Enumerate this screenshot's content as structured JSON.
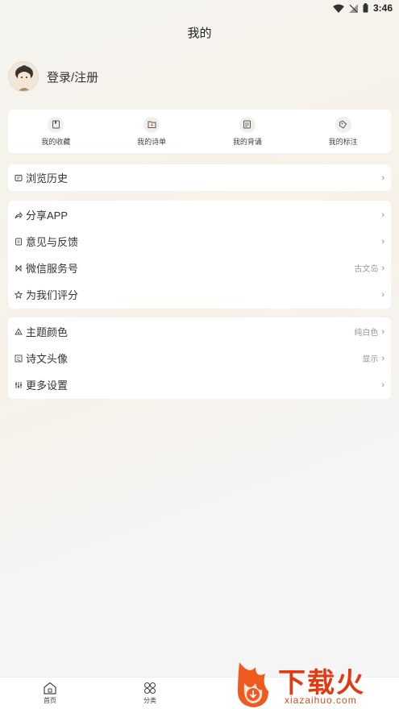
{
  "status": {
    "time": "3:46"
  },
  "page": {
    "title": "我的"
  },
  "profile": {
    "login_label": "登录/注册"
  },
  "quick_actions": [
    {
      "label": "我的收藏",
      "icon": "bookmark-icon"
    },
    {
      "label": "我的诗单",
      "icon": "folder-add-icon"
    },
    {
      "label": "我的背诵",
      "icon": "note-icon"
    },
    {
      "label": "我的标注",
      "icon": "tag-icon"
    }
  ],
  "history": {
    "label": "浏览历史",
    "icon": "history-icon"
  },
  "group1": [
    {
      "label": "分享APP",
      "value": "",
      "icon": "share-icon"
    },
    {
      "label": "意见与反馈",
      "value": "",
      "icon": "feedback-icon"
    },
    {
      "label": "微信服务号",
      "value": "古文岛",
      "icon": "wechat-icon"
    },
    {
      "label": "为我们评分",
      "value": "",
      "icon": "star-icon"
    }
  ],
  "group2": [
    {
      "label": "主题颜色",
      "value": "纯白色",
      "icon": "palette-icon"
    },
    {
      "label": "诗文头像",
      "value": "显示",
      "icon": "avatar-toggle-icon"
    },
    {
      "label": "更多设置",
      "value": "",
      "icon": "settings-icon"
    }
  ],
  "tabs": [
    {
      "label": "首页",
      "icon": "home-icon"
    },
    {
      "label": "分类",
      "icon": "category-icon"
    }
  ],
  "watermark": {
    "main": "下载火",
    "sub": "xiazaihuo.com"
  }
}
